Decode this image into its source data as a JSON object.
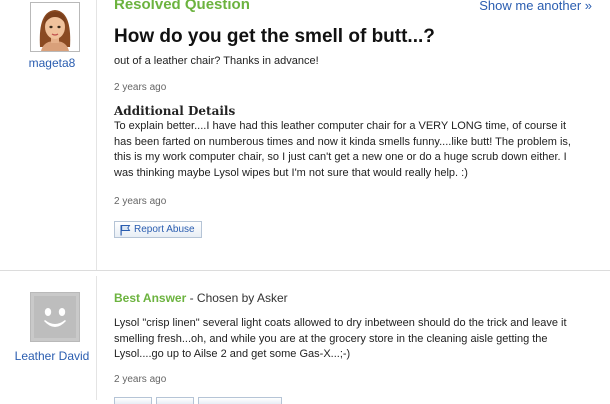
{
  "question": {
    "status_label": "Resolved Question",
    "show_another_label": "Show me another »",
    "title": "How do you get the smell of butt...?",
    "body": "out of a leather chair? Thanks in advance!",
    "time_ago": "2 years ago",
    "asker": {
      "name": "mageta8",
      "avatar_icon": "female-avatar-icon"
    },
    "additional_details": {
      "heading": "Additional Details",
      "body": "To explain better....I have had this leather computer chair for a VERY LONG time, of course it has been farted on numberous times and now it kinda smells funny....like butt! The problem is, this is my work computer chair, so I just can't get a new one or do a huge scrub down either. I was thinking maybe Lysol wipes but I'm not sure that would really help. :)",
      "time_ago": "2 years ago"
    },
    "report_abuse_label": "Report Abuse",
    "report_icon": "flag-icon"
  },
  "best_answer": {
    "label": "Best Answer",
    "chosen_by": " - Chosen by Asker",
    "answerer": {
      "name": "Leather David",
      "avatar_icon": "default-smiley-avatar-icon"
    },
    "body": "Lysol \"crisp linen\" several light coats allowed to dry inbetween should do the trick and leave it smelling fresh...oh, and while you are at the grocery store in the cleaning aisle getting the Lysol....go up to Ailse 2 and get some Gas-X...;-)",
    "time_ago": "2 years ago"
  },
  "colors": {
    "accent_green": "#6cb33f",
    "link_blue": "#2a5db0",
    "separator": "#dcdcdc"
  }
}
